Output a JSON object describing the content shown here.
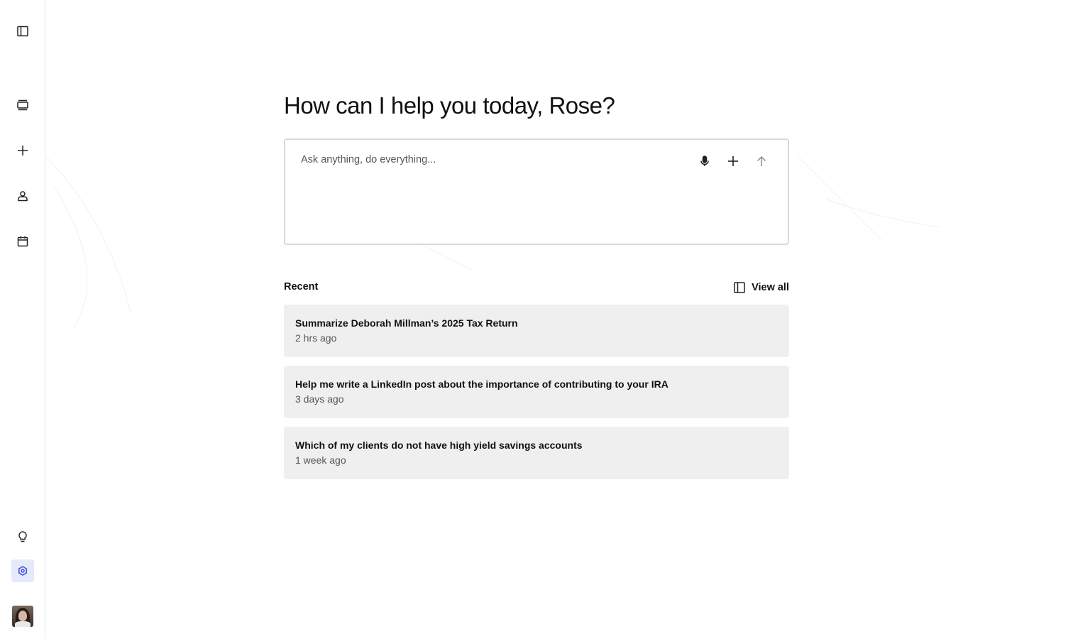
{
  "sidebar": {
    "icons": [
      "sidebar-toggle-icon",
      "conversations-icon",
      "plus-icon",
      "user-icon",
      "calendar-icon",
      "lightbulb-icon",
      "settings-icon"
    ],
    "active_color": "#e6e8fb",
    "active_icon_color": "#3b4fd8"
  },
  "main": {
    "title": "How can I help you today, Rose?",
    "composer": {
      "placeholder": "Ask anything, do everything...",
      "icons": [
        "microphone-icon",
        "plus-icon",
        "arrow-up-icon"
      ]
    },
    "recent": {
      "label": "Recent",
      "view_all_label": "View all",
      "items": [
        {
          "title": "Summarize Deborah Millman’s 2025 Tax Return",
          "time": "2 hrs ago"
        },
        {
          "title": "Help me write a LinkedIn post about the importance of contributing to your IRA",
          "time": "3 days ago"
        },
        {
          "title": "Which of my clients do not have high yield savings accounts",
          "time": "1 week ago"
        }
      ]
    }
  }
}
